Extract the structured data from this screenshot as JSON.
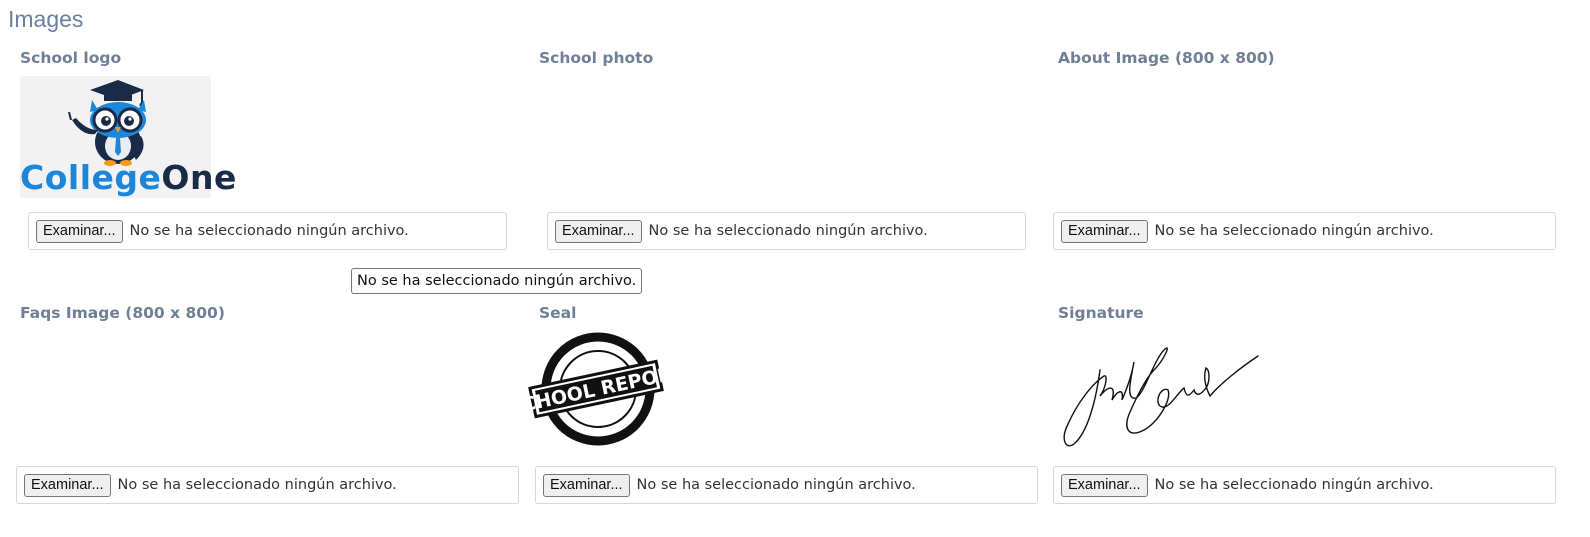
{
  "section": {
    "title": "Images"
  },
  "fields": [
    {
      "label": "School logo",
      "button": "Examinar...",
      "status": "No se ha seleccionado ningún archivo."
    },
    {
      "label": "School photo",
      "button": "Examinar...",
      "status": "No se ha seleccionado ningún archivo."
    },
    {
      "label": "About Image (800 x 800)",
      "button": "Examinar...",
      "status": "No se ha seleccionado ningún archivo."
    },
    {
      "label": "Faqs Image (800 x 800)",
      "button": "Examinar...",
      "status": "No se ha seleccionado ningún archivo."
    },
    {
      "label": "Seal",
      "button": "Examinar...",
      "status": "No se ha seleccionado ningún archivo."
    },
    {
      "label": "Signature",
      "button": "Examinar...",
      "status": "No se ha seleccionado ningún archivo."
    }
  ],
  "tooltip": {
    "text": "No se ha seleccionado ningún archivo."
  },
  "logo": {
    "word_part1": "College",
    "word_part2": "One"
  },
  "seal": {
    "text": "SCHOOL REPORT"
  },
  "colors": {
    "label": "#6f7f95",
    "title": "#6a80a0",
    "logo_blue": "#1c86d8",
    "logo_navy": "#1a2b48"
  }
}
